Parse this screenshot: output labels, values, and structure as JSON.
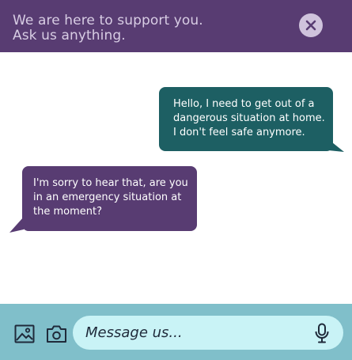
{
  "header": {
    "title": "We are here to support you.\nAsk us anything."
  },
  "messages": [
    {
      "sender": "user",
      "text": "Hello, I need to get out of a dangerous situation at home. I don't feel safe anymore."
    },
    {
      "sender": "support",
      "text": "I'm sorry to hear that, are you in an emergency situation at the moment?"
    }
  ],
  "composer": {
    "placeholder": "Message us..."
  },
  "icons": {
    "close": "close-icon",
    "image": "image-icon",
    "camera": "camera-icon",
    "mic": "microphone-icon"
  },
  "colors": {
    "header_bg": "#583c72",
    "support_bubble": "#583c72",
    "user_bubble": "#1d5f63",
    "footer_bg": "#80bfca",
    "input_bg": "#c9f3f6"
  }
}
